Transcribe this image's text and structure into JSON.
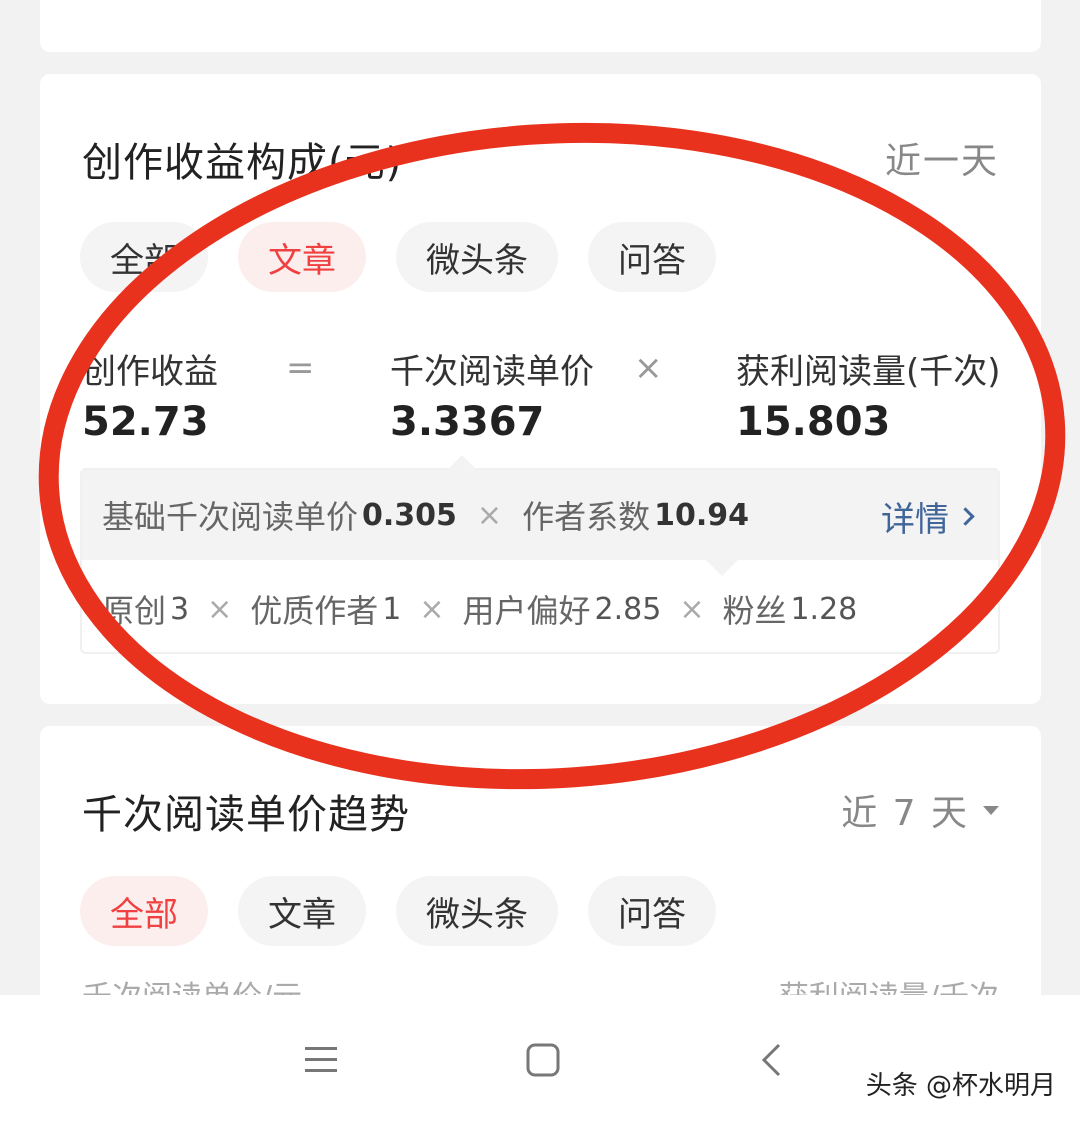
{
  "earnings_card": {
    "title": "创作收益构成(元)",
    "period": "近一天",
    "tabs": [
      {
        "label": "全部",
        "active": false
      },
      {
        "label": "文章",
        "active": true
      },
      {
        "label": "微头条",
        "active": false
      },
      {
        "label": "问答",
        "active": false
      }
    ],
    "formula": {
      "earnings_label": "创作收益",
      "earnings_value": "52.73",
      "equals": "=",
      "rpm_label": "千次阅读单价",
      "rpm_value": "3.3367",
      "times": "×",
      "reads_label": "获利阅读量(千次)",
      "reads_value": "15.803"
    },
    "detail": {
      "base_label": "基础千次阅读单价",
      "base_value": "0.305",
      "times": "×",
      "coef_label": "作者系数",
      "coef_value": "10.94",
      "link_label": "详情",
      "factors": [
        {
          "label": "原创",
          "value": "3"
        },
        {
          "label": "优质作者",
          "value": "1"
        },
        {
          "label": "用户偏好",
          "value": "2.85"
        },
        {
          "label": "粉丝",
          "value": "1.28"
        }
      ]
    }
  },
  "trend_card": {
    "title": "千次阅读单价趋势",
    "period": "近 7 天",
    "tabs": [
      {
        "label": "全部",
        "active": true
      },
      {
        "label": "文章",
        "active": false
      },
      {
        "label": "微头条",
        "active": false
      },
      {
        "label": "问答",
        "active": false
      }
    ],
    "left_axis_label": "千次阅读单价/元",
    "right_axis_label": "获利阅读量/千次"
  },
  "watermark": "头条 @杯水明月",
  "colors": {
    "accent_red": "#f04142",
    "link_blue": "#406599",
    "annotation_red": "#e8321e"
  }
}
